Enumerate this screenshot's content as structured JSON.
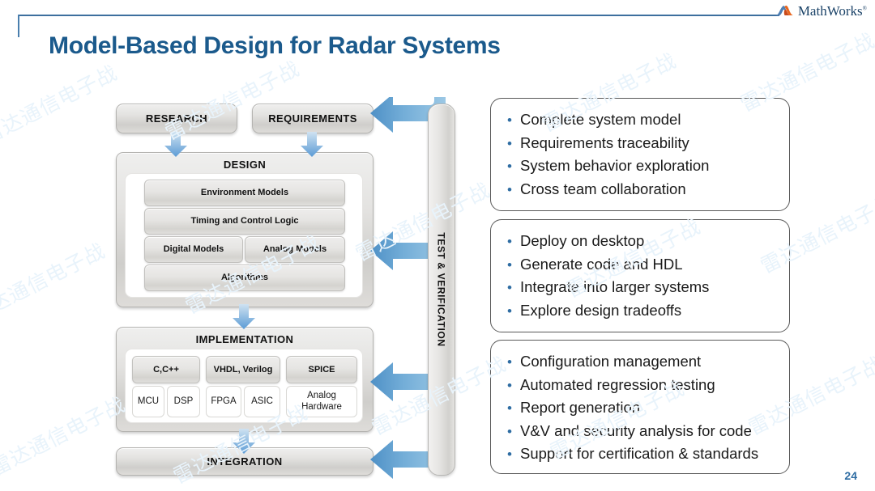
{
  "brand": {
    "name": "MathWorks",
    "trademark": "®",
    "logo_icon": "mathworks-membrane-logo"
  },
  "slide": {
    "title": "Model-Based Design for Radar Systems",
    "page_number": "24"
  },
  "watermark": {
    "text": "雷达通信电子战"
  },
  "diagram": {
    "top_boxes": [
      {
        "label": "RESEARCH"
      },
      {
        "label": "REQUIREMENTS"
      }
    ],
    "design": {
      "title": "DESIGN",
      "rows": [
        {
          "cells": [
            {
              "label": "Environment Models"
            }
          ]
        },
        {
          "cells": [
            {
              "label": "Timing and Control Logic"
            }
          ]
        },
        {
          "cells": [
            {
              "label": "Digital Models"
            },
            {
              "label": "Analog Models"
            }
          ]
        },
        {
          "cells": [
            {
              "label": "Algorithms"
            }
          ]
        }
      ]
    },
    "implementation": {
      "title": "IMPLEMENTATION",
      "top_row": [
        {
          "label": "C,C++"
        },
        {
          "label": "VHDL, Verilog"
        },
        {
          "label": "SPICE"
        }
      ],
      "bottom_row": [
        {
          "label": "MCU"
        },
        {
          "label": "DSP"
        },
        {
          "label": "FPGA"
        },
        {
          "label": "ASIC"
        },
        {
          "label": "Analog\nHardware"
        }
      ]
    },
    "integration": {
      "title": "INTEGRATION"
    },
    "verification_bar": {
      "label": "TEST & VERIFICATION"
    }
  },
  "panels": [
    {
      "items": [
        "Complete system model",
        "Requirements traceability",
        "System behavior exploration",
        "Cross team collaboration"
      ]
    },
    {
      "items": [
        "Deploy on desktop",
        "Generate code and HDL",
        "Integrate into larger systems",
        "Explore design tradeoffs"
      ]
    },
    {
      "items": [
        "Configuration management",
        "Automated regression testing",
        "Report generation",
        "V&V and security analysis for code",
        "Support for certification & standards"
      ]
    }
  ],
  "colors": {
    "title_blue": "#1b5a8c",
    "rule_blue": "#3d6f9e",
    "arrow_blue_light": "#c3dcee",
    "arrow_blue_dark": "#5b9bd5",
    "bullet_blue": "#2f6da3",
    "panel_border": "#595959",
    "box_gray": "#dedcd9",
    "watermark_blue": "#e8f3fb"
  }
}
